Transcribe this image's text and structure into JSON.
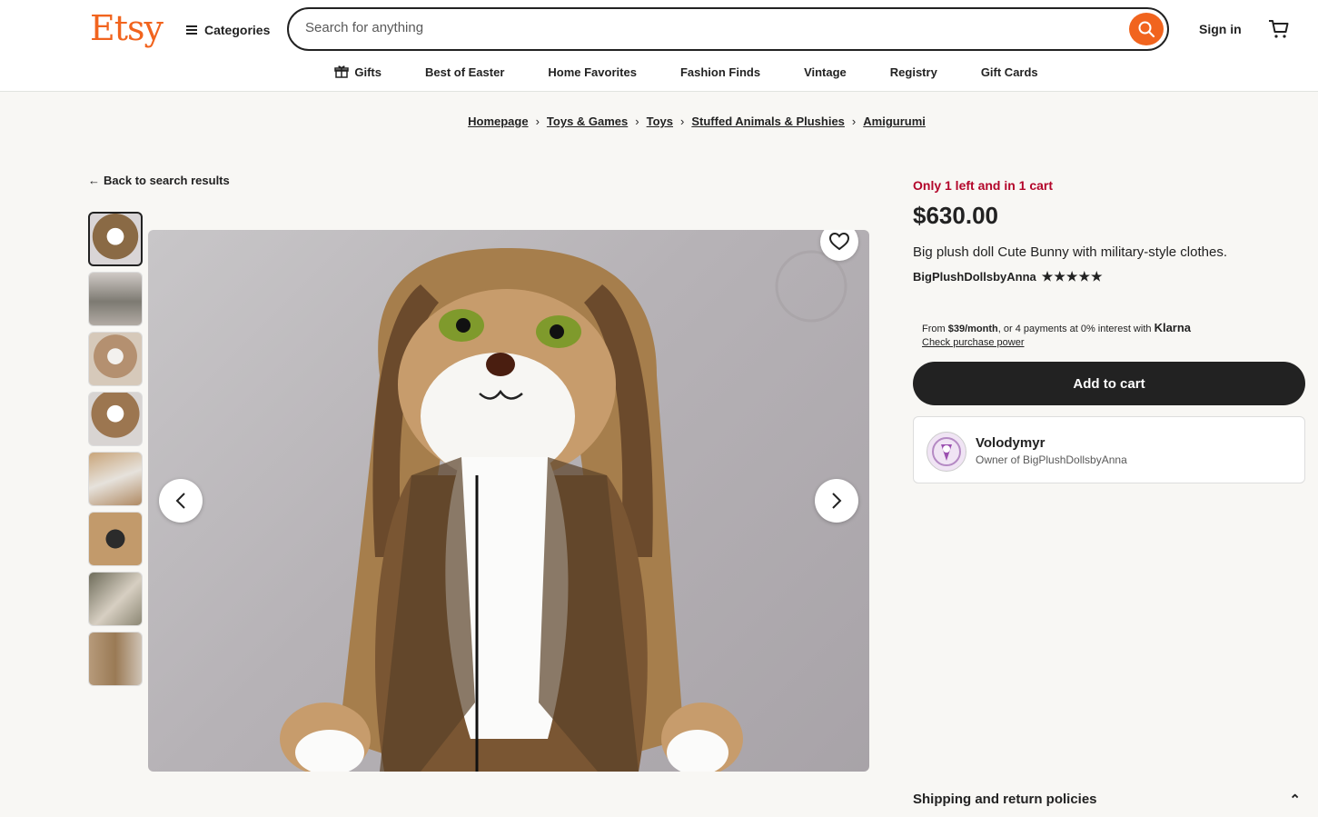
{
  "header": {
    "logo": "Etsy",
    "categories_label": "Categories",
    "search_placeholder": "Search for anything",
    "sign_in": "Sign in"
  },
  "nav": [
    "Gifts",
    "Best of Easter",
    "Home Favorites",
    "Fashion Finds",
    "Vintage",
    "Registry",
    "Gift Cards"
  ],
  "breadcrumbs": [
    "Homepage",
    "Toys & Games",
    "Toys",
    "Stuffed Animals & Plushies",
    "Amigurumi"
  ],
  "back_link": "Back to search results",
  "gallery": {
    "thumbnail_count": 8,
    "active_index": 0
  },
  "product": {
    "stock_notice": "Only 1 left and in 1 cart",
    "price": "$630.00",
    "title": "Big plush doll Cute Bunny with military-style clothes.",
    "shop_name": "BigPlushDollsbyAnna",
    "rating_stars": 5
  },
  "klarna": {
    "prefix": "From ",
    "amount": "$39/month",
    "middle": ", or 4 payments at 0% interest with ",
    "brand": "Klarna",
    "link": "Check purchase power"
  },
  "add_to_cart": "Add to cart",
  "owner": {
    "name": "Volodymyr",
    "role": "Owner of BigPlushDollsbyAnna"
  },
  "policies_label": "Shipping and return policies",
  "colors": {
    "brand": "#f1641e",
    "stock_red": "#b3062a",
    "button_dark": "#222222"
  }
}
